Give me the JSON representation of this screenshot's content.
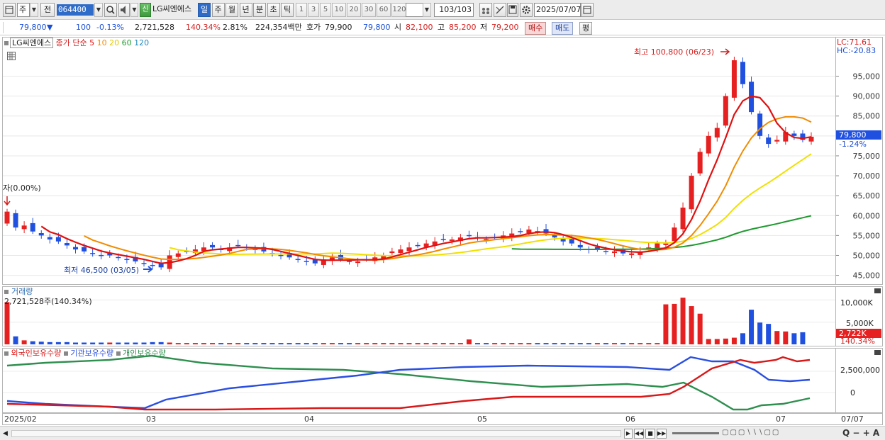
{
  "toolbar": {
    "period_main": "주",
    "prev_label": "전",
    "stock_code": "064400",
    "stock_name": "LG씨엔에스",
    "new_badge": "신",
    "periods": [
      "일",
      "주",
      "월",
      "년",
      "분",
      "초",
      "틱"
    ],
    "selected_period": "일",
    "minute_options": [
      "1",
      "3",
      "5",
      "10",
      "20",
      "30",
      "60",
      "120"
    ],
    "count": "103",
    "count_total": "/103",
    "date": "2025/07/07"
  },
  "quote": {
    "price": "79,800",
    "change_arrow": "▼",
    "change": "100",
    "change_rate": "-0.13%",
    "volume": "2,721,528",
    "volume_rate": "140.34%",
    "turnover": "2.81%",
    "amount": "224,354백만",
    "bid_label": "호가",
    "bid": "79,900",
    "ask": "79,800",
    "open_label": "시",
    "open": "82,100",
    "high_label": "고",
    "high": "85,200",
    "low_label": "저",
    "low": "79,200",
    "buy_label": "매수",
    "sell_label": "매도",
    "eval_label": "평"
  },
  "price_panel": {
    "stock_label": "LG씨엔에스",
    "ma_label": "종가 단순",
    "ma_periods": [
      "5",
      "10",
      "20",
      "60",
      "120"
    ],
    "lc": "LC:71.61",
    "hc": "HC:-20.83",
    "high_note": "최고 100,800 (06/23)",
    "low_note": "최저 46,500 (03/05)",
    "left_note": "자(0.00%)",
    "current_price": "79,800",
    "current_change": "-1.24%",
    "y_ticks": [
      "95,000",
      "90,000",
      "85,000",
      "80,000",
      "75,000",
      "70,000",
      "65,000",
      "60,000",
      "55,000",
      "50,000",
      "45,000"
    ]
  },
  "volume_panel": {
    "title": "거래량",
    "info": "2,721,528주(140.34%)",
    "y_ticks": [
      "10,000K",
      "5,000K"
    ],
    "current": "2,722K",
    "current_rate": "140.34%"
  },
  "holding_panel": {
    "series": [
      "외국인보유수량",
      "기관보유수량",
      "개인보유수량"
    ],
    "y_ticks": [
      "2,500,000",
      "0"
    ]
  },
  "x_axis": {
    "labels": [
      "2025/02",
      "03",
      "04",
      "05",
      "06",
      "07",
      "07/07"
    ]
  },
  "colors": {
    "up": "#e62020",
    "down": "#2050e0",
    "ma5": "#e01010",
    "ma10": "#f08c00",
    "ma20": "#f0e000",
    "ma60": "#1f9a2f",
    "ma120": "#1f88b8",
    "foreign": "#d81818",
    "institution": "#2a4fe0",
    "individual": "#2f8f4f"
  },
  "chart_data": {
    "type": "candlestick",
    "x_range": [
      "2025/02",
      "2025/07/07"
    ],
    "y_range": [
      43500,
      101500
    ],
    "last_candle": {
      "open": 82100,
      "high": 85200,
      "low": 79200,
      "close": 79800
    },
    "period_high": {
      "value": 100800,
      "date": "06/23"
    },
    "period_low": {
      "value": 46500,
      "date": "03/05"
    },
    "closes_approx": [
      61000,
      57000,
      57500,
      56000,
      55000,
      54000,
      53500,
      52500,
      51500,
      51000,
      50500,
      50000,
      50000,
      49500,
      49000,
      48500,
      48000,
      47500,
      47000,
      50000,
      50500,
      51000,
      51500,
      52000,
      52000,
      51500,
      52000,
      52500,
      52000,
      51500,
      51000,
      50500,
      50000,
      49500,
      49000,
      48500,
      48000,
      49000,
      49500,
      49000,
      48500,
      48500,
      49000,
      49500,
      50000,
      51000,
      51500,
      52000,
      52500,
      53000,
      53500,
      54000,
      54000,
      54500,
      55000,
      54500,
      54000,
      54500,
      55000,
      55500,
      56000,
      56500,
      56000,
      55500,
      54500,
      53500,
      53000,
      52000,
      51500,
      51500,
      51000,
      51000,
      50500,
      50500,
      51000,
      52000,
      53000,
      53000,
      57000,
      62000,
      70000,
      76000,
      80000,
      82000,
      90000,
      99000,
      93000,
      86000,
      80000,
      78000,
      79000,
      81000,
      80000,
      79000,
      79800
    ],
    "volume_k": [
      9500,
      1800,
      900,
      700,
      600,
      500,
      500,
      500,
      400,
      400,
      400,
      400,
      400,
      400,
      400,
      400,
      400,
      500,
      500,
      400,
      300,
      300,
      300,
      300,
      300,
      300,
      300,
      300,
      300,
      300,
      300,
      300,
      300,
      300,
      300,
      300,
      300,
      300,
      300,
      300,
      300,
      300,
      300,
      300,
      300,
      300,
      300,
      300,
      300,
      300,
      300,
      300,
      300,
      300,
      1100,
      300,
      300,
      300,
      300,
      300,
      300,
      300,
      300,
      300,
      300,
      300,
      300,
      300,
      300,
      300,
      300,
      300,
      300,
      300,
      300,
      300,
      300,
      9000,
      9100,
      10500,
      8600,
      6900,
      1200,
      1200,
      1300,
      1500,
      2500,
      7800,
      4900,
      4600,
      3000,
      2900,
      2500,
      2722
    ]
  }
}
